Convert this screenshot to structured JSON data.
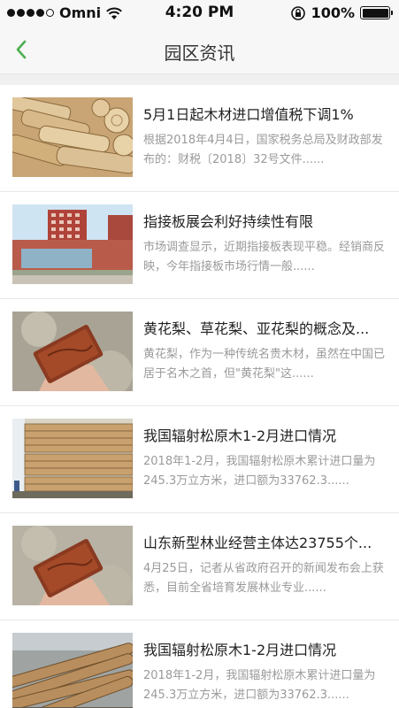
{
  "status_bar": {
    "carrier": "Omni",
    "time": "4:20 PM",
    "battery": "100%",
    "battery_level": 1.0,
    "icons": [
      "signal-dots",
      "wifi-icon",
      "rotation-lock-icon",
      "battery-icon"
    ]
  },
  "nav": {
    "title": "园区资讯",
    "back_icon": "chevron-left-icon",
    "accent_color": "#4caf50"
  },
  "news": [
    {
      "title": "5月1日起木材进口增值税下调1%",
      "summary": "根据2018年4月4日，国家税务总局及财政部发布的：财税〔2018〕32号文件......",
      "image": "stacked-logs"
    },
    {
      "title": "指接板展会利好持续性有限",
      "summary": "市场调查显示，近期指接板表现平稳。经销商反映，今年指接板市场行情一般......",
      "image": "office-building"
    },
    {
      "title": "黄花梨、草花梨、亚花梨的概念及...",
      "summary": "黄花梨，作为一种传统名贵木材，虽然在中国已居于名木之首，但\"黄花梨\"这......",
      "image": "hand-holding-wood-block"
    },
    {
      "title": "我国辐射松原木1-2月进口情况",
      "summary": "2018年1-2月，我国辐射松原木累计进口量为245.3万立方米，进口额为33762.3......",
      "image": "lumber-stacks"
    },
    {
      "title": "山东新型林业经营主体达23755个...",
      "summary": "4月25日，记者从省政府召开的新闻发布会上获悉，目前全省培育发展林业专业......",
      "image": "hand-holding-wood-block"
    },
    {
      "title": "我国辐射松原木1-2月进口情况",
      "summary": "2018年1-2月，我国辐射松原木累计进口量为245.3万立方米，进口额为33762.3......",
      "image": "log-pile"
    }
  ]
}
